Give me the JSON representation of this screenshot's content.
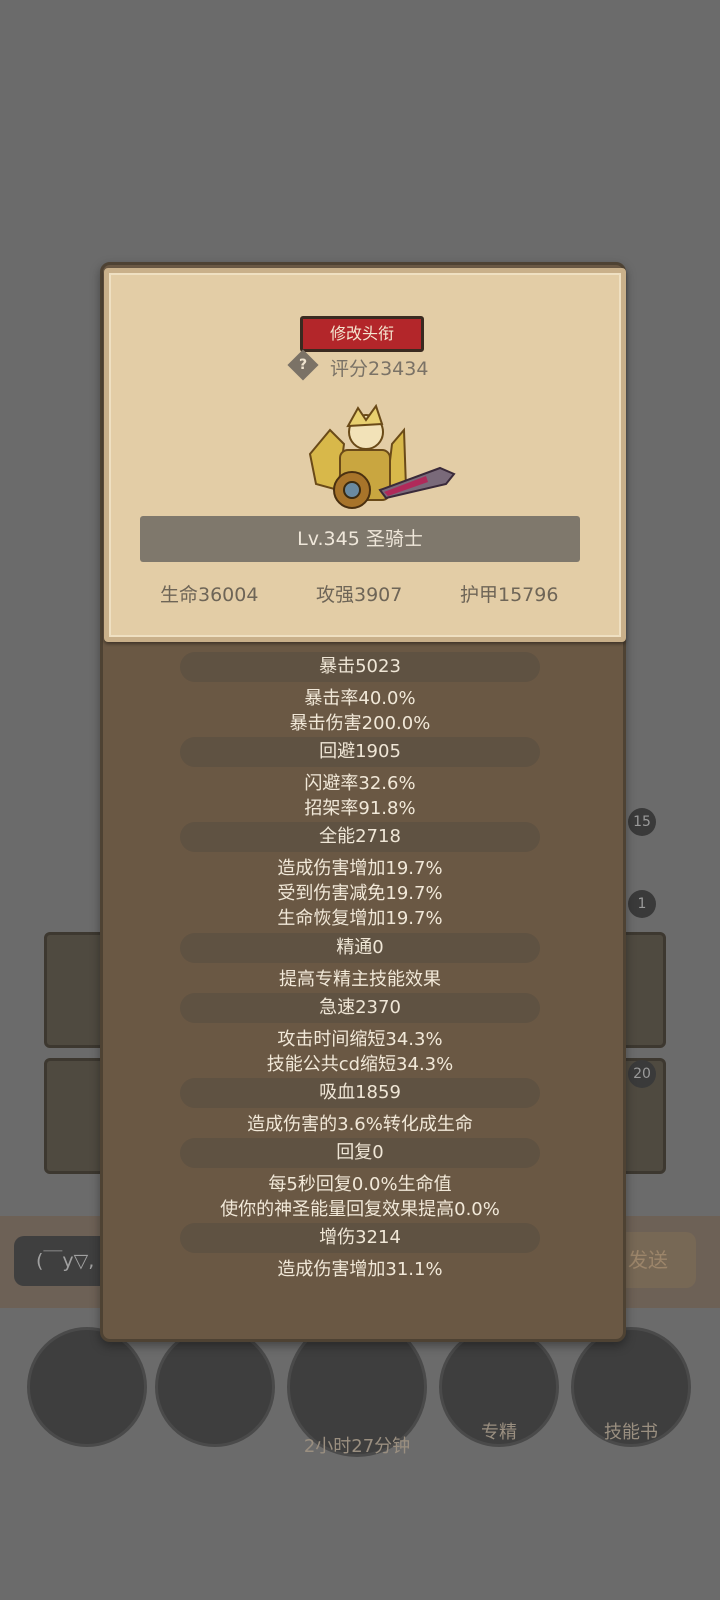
{
  "badges": [
    "15",
    "1",
    "20"
  ],
  "chat": {
    "placeholder": "(￣y▽,",
    "send": "发送"
  },
  "bottom": {
    "timer": "2小时27分钟",
    "specialize": "专精",
    "skillbook": "技能书"
  },
  "card": {
    "rename_button": "修改头衔",
    "help_icon": "?",
    "score": "评分23434",
    "level": "Lv.345 圣骑士",
    "hp": "生命36004",
    "attack": "攻强3907",
    "armor": "护甲15796"
  },
  "stats": {
    "crit": "暴击5023",
    "crit_rate": "暴击率40.0%",
    "crit_dmg": "暴击伤害200.0%",
    "dodge": "回避1905",
    "dodge_rate": "闪避率32.6%",
    "parry_rate": "招架率91.8%",
    "versatility": "全能2718",
    "vers_dmg": "造成伤害增加19.7%",
    "vers_reduce": "受到伤害减免19.7%",
    "vers_heal": "生命恢复增加19.7%",
    "mastery": "精通0",
    "mastery_desc": "提高专精主技能效果",
    "haste": "急速2370",
    "haste_attack": "攻击时间缩短34.3%",
    "haste_cd": "技能公共cd缩短34.3%",
    "leech": "吸血1859",
    "leech_desc": "造成伤害的3.6%转化成生命",
    "regen": "回复0",
    "regen_hp": "每5秒回复0.0%生命值",
    "regen_holy": "使你的神圣能量回复效果提高0.0%",
    "dmg_bonus": "增伤3214",
    "dmg_bonus_desc": "造成伤害增加31.1%"
  },
  "colors": {
    "modal_bg": "#6a5844",
    "card_bg": "#e3cda6",
    "rename_red": "#b3262a"
  }
}
